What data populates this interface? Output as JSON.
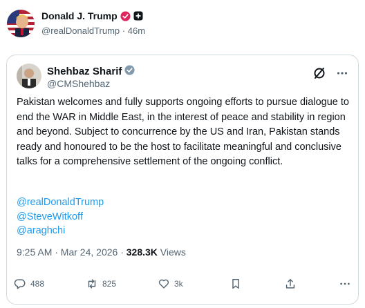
{
  "author": {
    "name": "Donald J. Trump",
    "handle": "@realDonaldTrump",
    "time": "46m"
  },
  "quote": {
    "name": "Shehbaz Sharif",
    "handle": "@CMShehbaz",
    "text": "Pakistan welcomes and fully supports ongoing efforts to pursue dialogue to end the WAR in Middle East, in the interest of peace and stability in region and beyond. Subject to concurrence by the US and Iran, Pakistan stands ready and honoured to be the host to facilitate meaningful and conclusive talks for a comprehensive settlement of the ongoing conflict.",
    "mentions": [
      "@realDonaldTrump",
      "@SteveWitkoff",
      "@araghchi"
    ],
    "timestamp": "9:25 AM · Mar 24, 2026 · ",
    "views_count": "328.3K",
    "views_label": " Views"
  },
  "actions": {
    "replies": "488",
    "reposts": "825",
    "likes": "3k"
  },
  "colors": {
    "link": "#1d9bf0",
    "secondary_text": "#536471",
    "border": "#cfd9de"
  }
}
